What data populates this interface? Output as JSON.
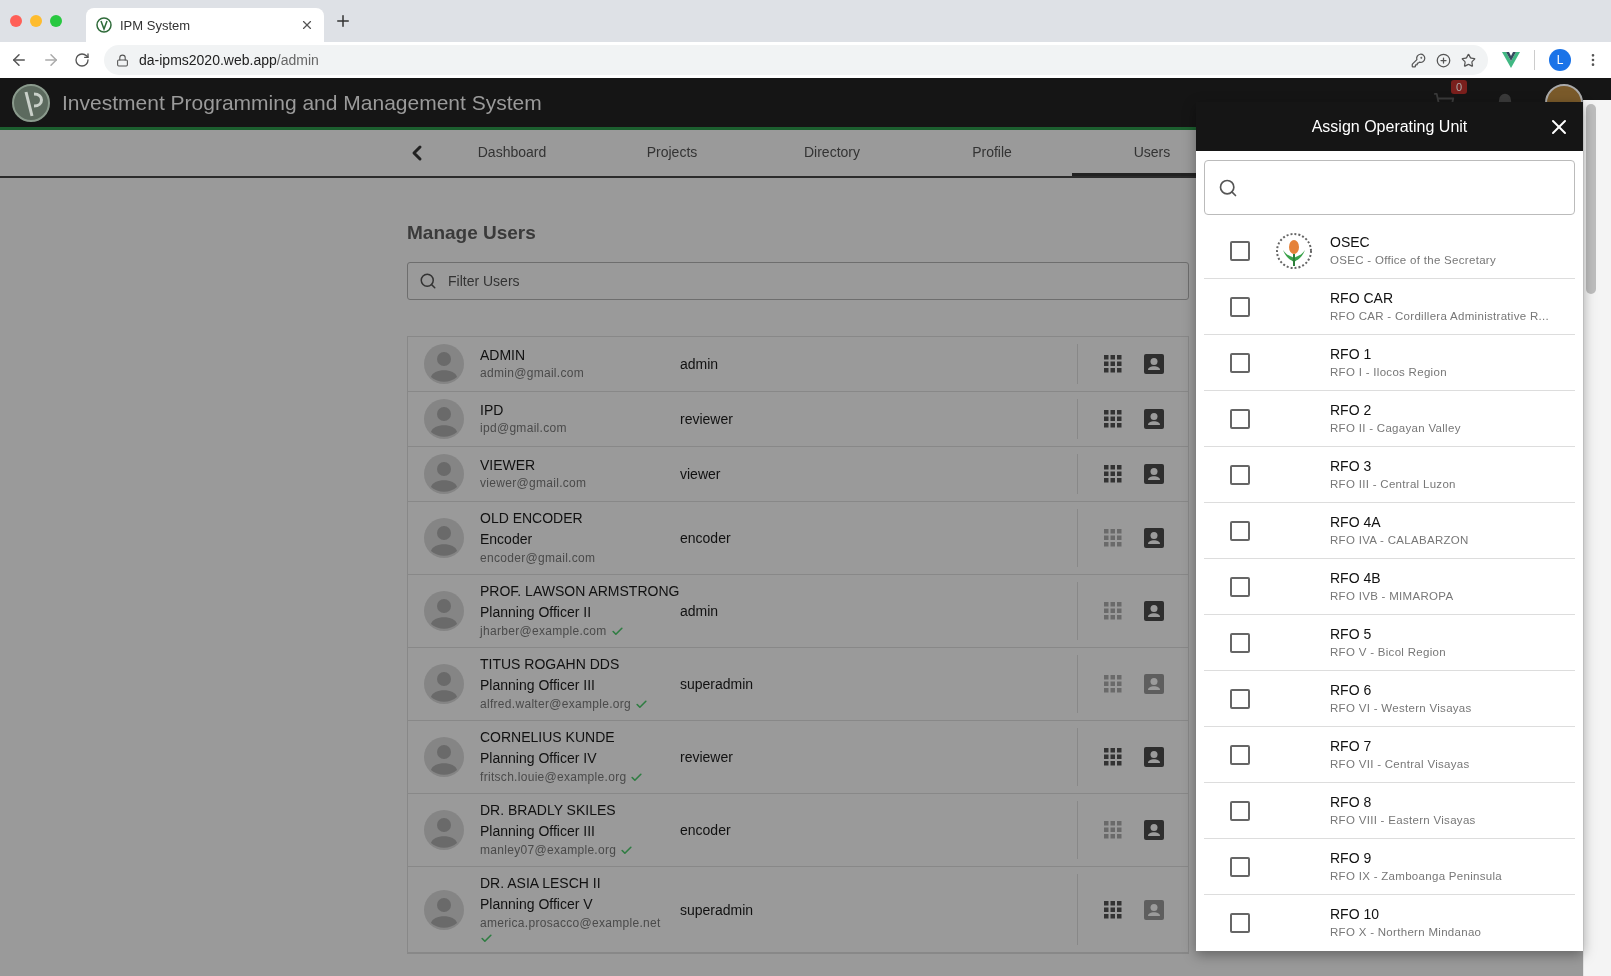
{
  "browser": {
    "tab_title": "IPM System",
    "url_host": "da-ipms2020.web.app",
    "url_path": "/admin",
    "profile_initial": "L"
  },
  "app": {
    "title": "Investment Programming and Management System",
    "cart_count": "0"
  },
  "nav": {
    "tabs": [
      {
        "label": "Dashboard",
        "selected": false
      },
      {
        "label": "Projects",
        "selected": false
      },
      {
        "label": "Directory",
        "selected": false
      },
      {
        "label": "Profile",
        "selected": false
      },
      {
        "label": "Users",
        "selected": true
      }
    ]
  },
  "page": {
    "heading": "Manage Users",
    "filter_placeholder": "Filter Users"
  },
  "users": [
    {
      "name": "ADMIN",
      "email": "admin@gmail.com",
      "role": "admin",
      "verified": false,
      "apps_active": true,
      "profile_active": true
    },
    {
      "name": "IPD",
      "email": "ipd@gmail.com",
      "role": "reviewer",
      "verified": false,
      "apps_active": true,
      "profile_active": true
    },
    {
      "name": "VIEWER",
      "email": "viewer@gmail.com",
      "role": "viewer",
      "verified": false,
      "apps_active": true,
      "profile_active": true
    },
    {
      "name": "OLD ENCODER",
      "position": "Encoder",
      "email": "encoder@gmail.com",
      "role": "encoder",
      "verified": false,
      "apps_active": false,
      "profile_active": true
    },
    {
      "name": "PROF. LAWSON ARMSTRONG",
      "position": "Planning Officer II",
      "email": "jharber@example.com",
      "role": "admin",
      "verified": true,
      "apps_active": false,
      "profile_active": true
    },
    {
      "name": "TITUS ROGAHN DDS",
      "position": "Planning Officer III",
      "email": "alfred.walter@example.org",
      "role": "superadmin",
      "verified": true,
      "apps_active": false,
      "profile_active": false
    },
    {
      "name": "CORNELIUS KUNDE",
      "position": "Planning Officer IV",
      "email": "fritsch.louie@example.org",
      "role": "reviewer",
      "verified": true,
      "apps_active": true,
      "profile_active": true
    },
    {
      "name": "DR. BRADLY SKILES",
      "position": "Planning Officer III",
      "email": "manley07@example.org",
      "role": "encoder",
      "verified": true,
      "apps_active": false,
      "profile_active": true
    },
    {
      "name": "DR. ASIA LESCH II",
      "position": "Planning Officer V",
      "email": "america.prosacco@example.net",
      "role": "superadmin",
      "verified": true,
      "apps_active": true,
      "profile_active": false
    }
  ],
  "drawer": {
    "title": "Assign Operating Unit",
    "units": [
      {
        "code": "OSEC",
        "description": "OSEC - Office of the Secretary",
        "checked": false,
        "has_logo": true
      },
      {
        "code": "RFO CAR",
        "description": "RFO CAR - Cordillera Administrative R...",
        "checked": false,
        "has_logo": false
      },
      {
        "code": "RFO 1",
        "description": "RFO I - Ilocos Region",
        "checked": false,
        "has_logo": false
      },
      {
        "code": "RFO 2",
        "description": "RFO II - Cagayan Valley",
        "checked": false,
        "has_logo": false
      },
      {
        "code": "RFO 3",
        "description": "RFO III - Central Luzon",
        "checked": false,
        "has_logo": false
      },
      {
        "code": "RFO 4A",
        "description": "RFO IVA - CALABARZON",
        "checked": false,
        "has_logo": false
      },
      {
        "code": "RFO 4B",
        "description": "RFO IVB - MIMAROPA",
        "checked": false,
        "has_logo": false
      },
      {
        "code": "RFO 5",
        "description": "RFO V - Bicol Region",
        "checked": false,
        "has_logo": false
      },
      {
        "code": "RFO 6",
        "description": "RFO VI - Western Visayas",
        "checked": false,
        "has_logo": false
      },
      {
        "code": "RFO 7",
        "description": "RFO VII - Central Visayas",
        "checked": false,
        "has_logo": false
      },
      {
        "code": "RFO 8",
        "description": "RFO VIII - Eastern Visayas",
        "checked": false,
        "has_logo": false
      },
      {
        "code": "RFO 9",
        "description": "RFO IX - Zamboanga Peninsula",
        "checked": false,
        "has_logo": false
      },
      {
        "code": "RFO 10",
        "description": "RFO X - Northern Mindanao",
        "checked": false,
        "has_logo": false
      }
    ]
  }
}
